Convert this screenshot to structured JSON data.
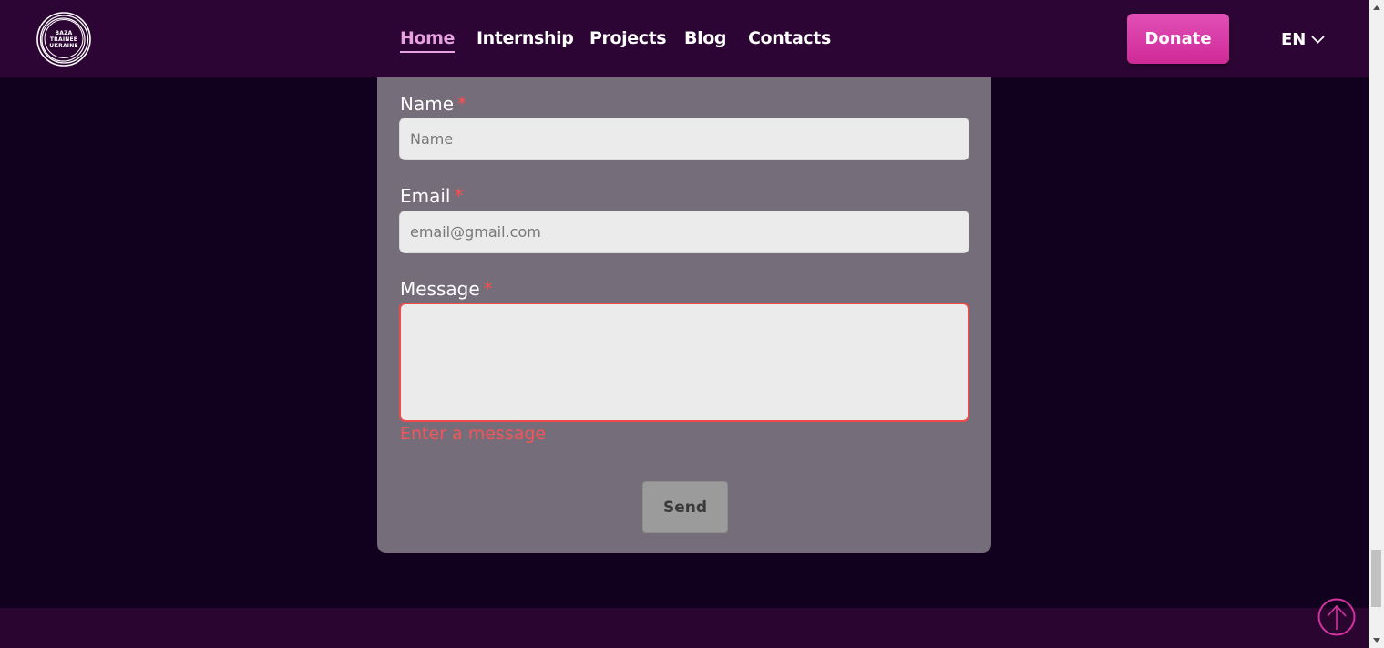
{
  "logo": {
    "lines": [
      "BAZA",
      "TRAINEE",
      "UKRAINE"
    ]
  },
  "nav": [
    {
      "label": "Home",
      "active": true
    },
    {
      "label": "Internship",
      "active": false
    },
    {
      "label": "Projects",
      "active": false
    },
    {
      "label": "Blog",
      "active": false
    },
    {
      "label": "Contacts",
      "active": false
    }
  ],
  "donate_label": "Donate",
  "language": "EN",
  "form": {
    "name_label": "Name",
    "name_placeholder": "Name",
    "email_label": "Email",
    "email_placeholder": "email@gmail.com",
    "message_label": "Message",
    "required_mark": "*",
    "message_error": "Enter a message",
    "send_label": "Send"
  },
  "colors": {
    "header_bg": "#2d0534",
    "page_bg": "#12011e",
    "accent": "#d4329f",
    "nav_active": "#e5a1e0",
    "error": "#f2555a"
  }
}
